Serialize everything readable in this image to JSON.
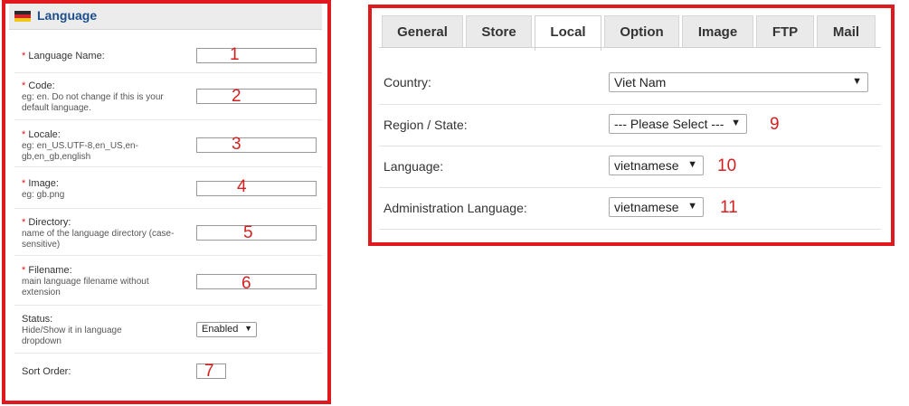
{
  "left_panel": {
    "title": "Language",
    "flag_colors": [
      "#2b2b2b",
      "#d4232b",
      "#f2c71c"
    ],
    "fields": [
      {
        "label": "Language Name:",
        "help": "",
        "required": true,
        "marker": "1"
      },
      {
        "label": "Code:",
        "help": "eg: en. Do not change if this is your default language.",
        "required": true,
        "marker": "2"
      },
      {
        "label": "Locale:",
        "help": "eg: en_US.UTF-8,en_US,en-gb,en_gb,english",
        "required": true,
        "marker": "3"
      },
      {
        "label": "Image:",
        "help": "eg: gb.png",
        "required": true,
        "marker": "4"
      },
      {
        "label": "Directory:",
        "help": "name of the language directory (case-sensitive)",
        "required": true,
        "marker": "5"
      },
      {
        "label": "Filename:",
        "help": "main language filename without extension",
        "required": true,
        "marker": "6"
      }
    ],
    "status": {
      "label": "Status:",
      "help": "Hide/Show it in language dropdown",
      "value": "Enabled"
    },
    "sort_order": {
      "label": "Sort Order:",
      "marker": "7"
    }
  },
  "right_panel": {
    "tabs": [
      "General",
      "Store",
      "Local",
      "Option",
      "Image",
      "FTP",
      "Mail"
    ],
    "active_tab": "Local",
    "rows": [
      {
        "label": "Country:",
        "value": "Viet Nam",
        "marker": ""
      },
      {
        "label": "Region / State:",
        "value": "--- Please Select ---",
        "marker": "9"
      },
      {
        "label": "Language:",
        "value": "vietnamese",
        "marker": "10"
      },
      {
        "label": "Administration Language:",
        "value": "vietnamese",
        "marker": "11"
      }
    ]
  },
  "colors": {
    "frame": "#e0191f",
    "annotation": "#d42020",
    "title": "#1c4f8b"
  }
}
